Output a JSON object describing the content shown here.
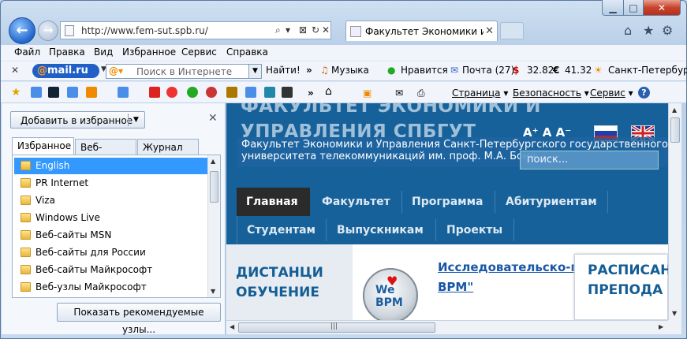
{
  "window": {
    "min_glyph": "▁",
    "max_glyph": "□",
    "close_glyph": "✕"
  },
  "address": {
    "url": "http://www.fem-sut.spb.ru/",
    "icons": [
      "⌕",
      "▾",
      "⊠",
      "↻",
      "✕"
    ]
  },
  "tab": {
    "title": "Факультет Экономики и У...",
    "close": "✕"
  },
  "right_icons": {
    "home": "⌂",
    "star": "★",
    "gear": "⚙"
  },
  "menu": [
    "Файл",
    "Правка",
    "Вид",
    "Избранное",
    "Сервис",
    "Справка"
  ],
  "mail_toolbar": {
    "close": "✕",
    "logo_at": "@",
    "logo_text": "mail",
    "logo_ru": ".ru",
    "search_placeholder": "Поиск в Интернете",
    "go": "Найти!",
    "chev": "»",
    "items": [
      "Музыка",
      "Нравится",
      "Почта (27)",
      "32.82",
      "41.32",
      "Санкт-Петербург"
    ],
    "currency": [
      "$",
      "€"
    ]
  },
  "fav_toolbar": {
    "chev": "»",
    "page": "Страница",
    "safety": "Безопасность",
    "tools": "Сервис",
    "help": "?"
  },
  "panel": {
    "add_button": "Добавить в избранное",
    "close": "✕",
    "tabs": [
      "Избранное",
      "Веб-каналы",
      "Журнал"
    ],
    "items": [
      "English",
      "PR Internet",
      "Viza",
      "Windows Live",
      "Веб-сайты MSN",
      "Веб-сайты для России",
      "Веб-сайты Майкрософт",
      "Веб-узлы Майкрософт"
    ],
    "show_recommended": "Показать рекомендуемые узлы..."
  },
  "site": {
    "big_title_1": "ФАКУЛЬТЕТ ЭКОНОМИКИ И",
    "big_title_2": "УПРАВЛЕНИЯ СПБГУТ",
    "subtitle_1": "Факультет Экономики и Управления Санкт-Петербургского государственного",
    "subtitle_2": "университета телекоммуникаций им. проф. М.А. Бонч",
    "font_sizes": "A⁺ A A⁻",
    "search_placeholder": "поиск...",
    "nav_row1": [
      "Главная",
      "Факультет",
      "Программа",
      "Абитуриентам"
    ],
    "nav_row2": [
      "Студентам",
      "Выпускникам",
      "Проекты"
    ],
    "side_1": "ДИСТАНЦИ",
    "side_2": "ОБУЧЕНИЕ",
    "badge": "We BPM",
    "article_1": "Исследовательско-пр",
    "article_2": "BPM\"",
    "sched_1": "РАСПИСАН",
    "sched_2": "ПРЕПОДА"
  },
  "colors": {
    "site_header": "#16619a",
    "nav_active": "#2b2b2b",
    "selection": "#3399ff",
    "link": "#1756a8"
  }
}
